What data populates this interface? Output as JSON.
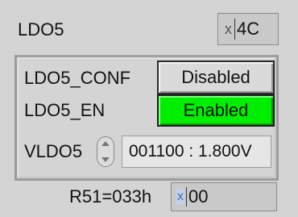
{
  "title": "LDO5",
  "address": {
    "prefix": "x",
    "value": "4C"
  },
  "conf": {
    "label": "LDO5_CONF",
    "button": "Disabled"
  },
  "en": {
    "label": "LDO5_EN",
    "button": "Enabled"
  },
  "vldo": {
    "label": "VLDO5",
    "value": "001100 : 1.800V"
  },
  "register": {
    "label": "R51=033h",
    "prefix": "x",
    "value": "00"
  },
  "colors": {
    "enabled_green": "#00ee00",
    "panel_bg": "#d4d4d4"
  }
}
